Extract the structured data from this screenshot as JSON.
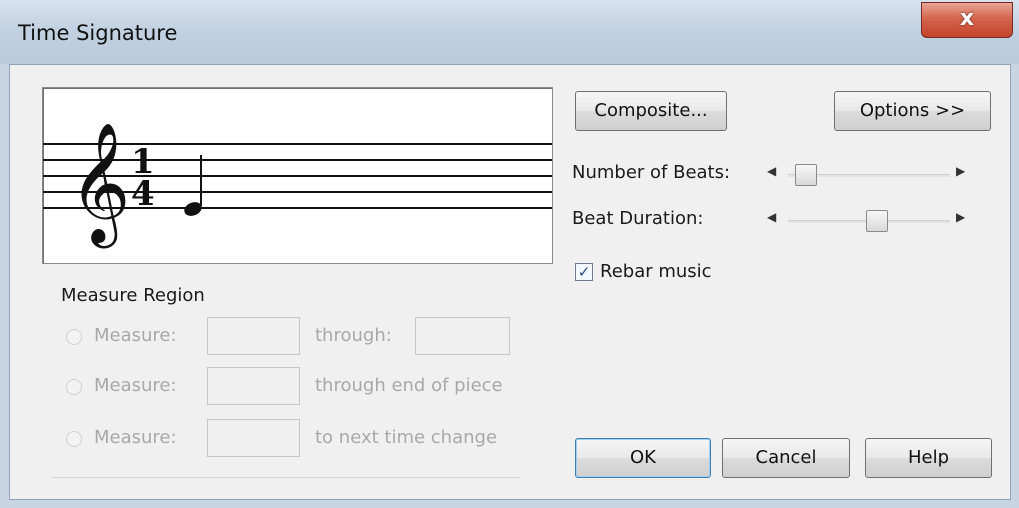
{
  "window": {
    "title": "Time Signature",
    "close_glyph": "x"
  },
  "preview": {
    "clef_glyph": "𝄞",
    "time_top": "1",
    "time_bottom": "4",
    "note_glyph": "♩"
  },
  "buttons": {
    "composite": "Composite...",
    "options": "Options >>",
    "ok": "OK",
    "cancel": "Cancel",
    "help": "Help"
  },
  "sliders": {
    "beats_label": "Number of Beats:",
    "beats_level": 0.1,
    "duration_label": "Beat Duration:",
    "duration_level": 0.6
  },
  "rebar": {
    "label": "Rebar music",
    "checked": true,
    "check_glyph": "✓"
  },
  "region": {
    "title": "Measure Region",
    "rows": [
      {
        "label": "Measure:",
        "suffix": "through:"
      },
      {
        "label": "Measure:",
        "suffix": "through end of piece"
      },
      {
        "label": "Measure:",
        "suffix": "to next time change"
      }
    ]
  },
  "colors": {
    "accent_close": "#c4432b",
    "title_bar": "#c3d2e2",
    "disabled_text": "#a8a8a8"
  }
}
